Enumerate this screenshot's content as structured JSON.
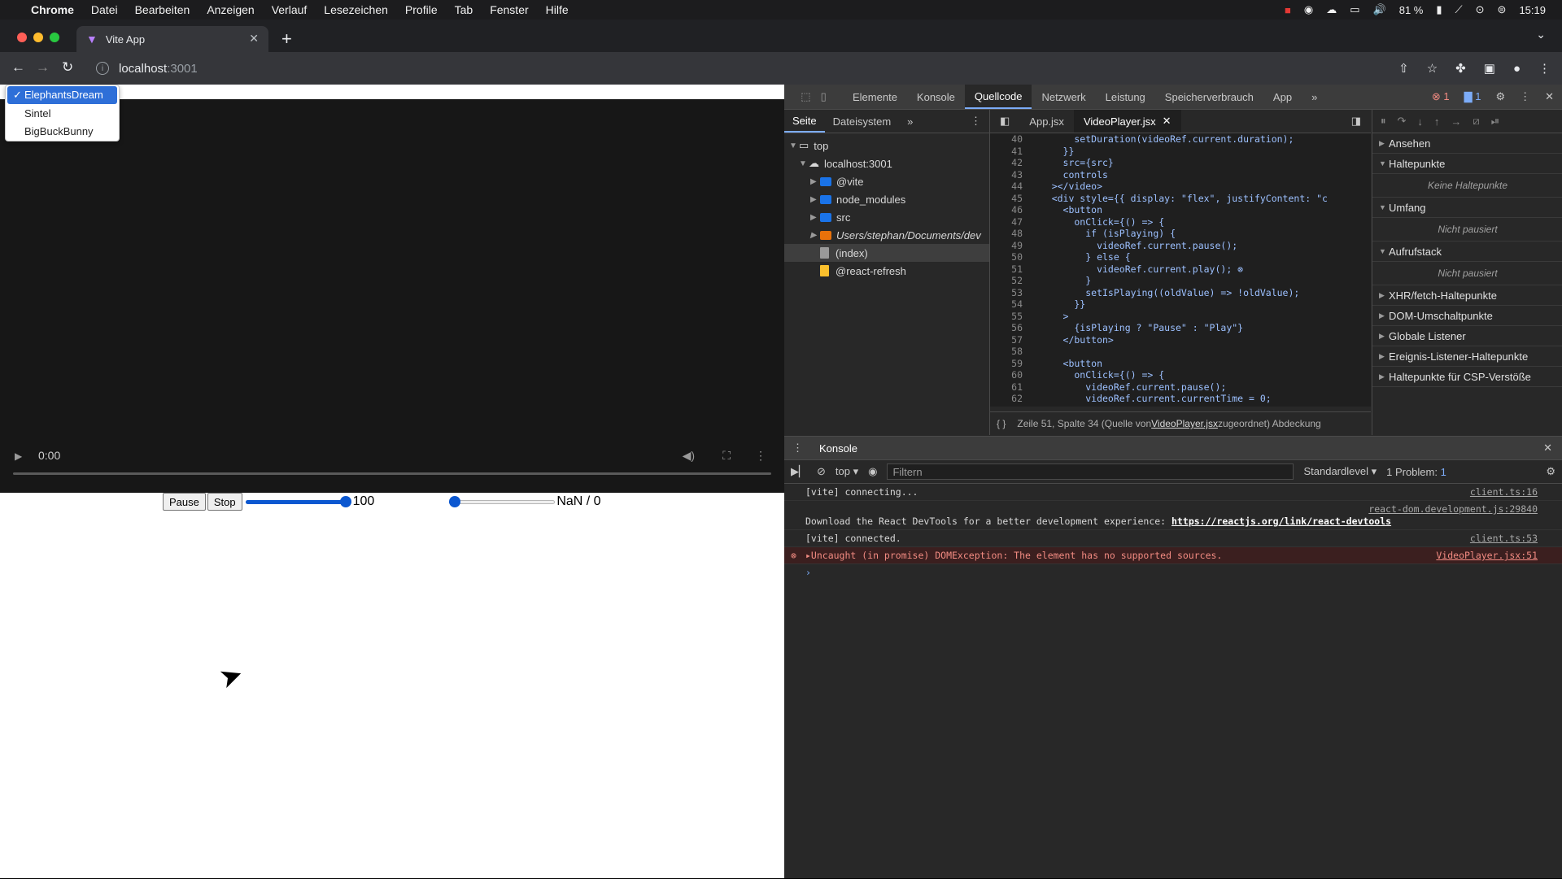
{
  "menubar": {
    "app": "Chrome",
    "items": [
      "Datei",
      "Bearbeiten",
      "Anzeigen",
      "Verlauf",
      "Lesezeichen",
      "Profile",
      "Tab",
      "Fenster",
      "Hilfe"
    ],
    "battery": "81 %",
    "clock": "15:19"
  },
  "browser": {
    "tab_title": "Vite App",
    "url_host": "localhost",
    "url_port": ":3001"
  },
  "page": {
    "dropdown": {
      "options": [
        "ElephantsDream",
        "Sintel",
        "BigBuckBunny"
      ],
      "selected": "ElephantsDream"
    },
    "video": {
      "time": "0:00"
    },
    "controls": {
      "pause_label": "Pause",
      "stop_label": "Stop",
      "volume_value": "100",
      "volume_fraction": 1.0,
      "progress_fraction": 0.0,
      "time_text": "NaN / 0"
    }
  },
  "devtools": {
    "tabs": [
      "Elemente",
      "Konsole",
      "Quellcode",
      "Netzwerk",
      "Leistung",
      "Speicherverbrauch",
      "App"
    ],
    "active_tab": "Quellcode",
    "error_count": "1",
    "message_count": "1",
    "navigator": {
      "tabs": [
        "Seite",
        "Dateisystem"
      ],
      "tree": [
        {
          "label": "top",
          "type": "frame"
        },
        {
          "label": "localhost:3001",
          "type": "cloud"
        },
        {
          "label": "@vite",
          "type": "folder"
        },
        {
          "label": "node_modules",
          "type": "folder"
        },
        {
          "label": "src",
          "type": "folder"
        },
        {
          "label": "Users/stephan/Documents/dev",
          "type": "folder-orange"
        },
        {
          "label": "(index)",
          "type": "file"
        },
        {
          "label": "@react-refresh",
          "type": "file-yellow"
        }
      ]
    },
    "editor": {
      "tabs": [
        "App.jsx",
        "VideoPlayer.jsx"
      ],
      "active_tab": "VideoPlayer.jsx",
      "lines": [
        {
          "n": "40",
          "code": "        setDuration(videoRef.current.duration);"
        },
        {
          "n": "41",
          "code": "      }}"
        },
        {
          "n": "42",
          "code": "      src={src}"
        },
        {
          "n": "43",
          "code": "      controls"
        },
        {
          "n": "44",
          "code": "    ></video>"
        },
        {
          "n": "45",
          "code": "    <div style={{ display: \"flex\", justifyContent: \"c"
        },
        {
          "n": "46",
          "code": "      <button"
        },
        {
          "n": "47",
          "code": "        onClick={() => {"
        },
        {
          "n": "48",
          "code": "          if (isPlaying) {"
        },
        {
          "n": "49",
          "code": "            videoRef.current.pause();"
        },
        {
          "n": "50",
          "code": "          } else {"
        },
        {
          "n": "51",
          "code": "            videoRef.current.play(); ⊗"
        },
        {
          "n": "52",
          "code": "          }"
        },
        {
          "n": "53",
          "code": "          setIsPlaying((oldValue) => !oldValue);"
        },
        {
          "n": "54",
          "code": "        }}"
        },
        {
          "n": "55",
          "code": "      >"
        },
        {
          "n": "56",
          "code": "        {isPlaying ? \"Pause\" : \"Play\"}"
        },
        {
          "n": "57",
          "code": "      </button>"
        },
        {
          "n": "58",
          "code": ""
        },
        {
          "n": "59",
          "code": "      <button"
        },
        {
          "n": "60",
          "code": "        onClick={() => {"
        },
        {
          "n": "61",
          "code": "          videoRef.current.pause();"
        },
        {
          "n": "62",
          "code": "          videoRef.current.currentTime = 0;"
        }
      ],
      "status_prefix": "Zeile 51, Spalte 34  (Quelle von ",
      "status_link": "VideoPlayer.jsx",
      "status_suffix": " zugeordnet)  Abdeckung"
    },
    "debugger": {
      "sections": [
        {
          "label": "Ansehen",
          "open": false
        },
        {
          "label": "Haltepunkte",
          "open": true,
          "empty": "Keine Haltepunkte"
        },
        {
          "label": "Umfang",
          "open": true,
          "empty": "Nicht pausiert"
        },
        {
          "label": "Aufrufstack",
          "open": true,
          "empty": "Nicht pausiert"
        },
        {
          "label": "XHR/fetch-Haltepunkte",
          "open": false
        },
        {
          "label": "DOM-Umschaltpunkte",
          "open": false
        },
        {
          "label": "Globale Listener",
          "open": false
        },
        {
          "label": "Ereignis-Listener-Haltepunkte",
          "open": false
        },
        {
          "label": "Haltepunkte für CSP-Verstöße",
          "open": false
        }
      ]
    },
    "console": {
      "drawer_tab": "Konsole",
      "context": "top",
      "filter_placeholder": "Filtern",
      "level": "Standardlevel",
      "problems": "1 Problem:",
      "problems_count": "1",
      "messages": [
        {
          "text": "[vite] connecting...",
          "src": "client.ts:16",
          "level": "info"
        },
        {
          "text": "Download the React DevTools for a better development experience: ",
          "link": "https://reactjs.org/link/react-devtools",
          "src": "react-dom.development.js:29840",
          "level": "info"
        },
        {
          "text": "[vite] connected.",
          "src": "client.ts:53",
          "level": "info"
        },
        {
          "text": "▸Uncaught (in promise) DOMException: The element has no supported sources.",
          "src": "VideoPlayer.jsx:51",
          "level": "error"
        }
      ]
    }
  }
}
